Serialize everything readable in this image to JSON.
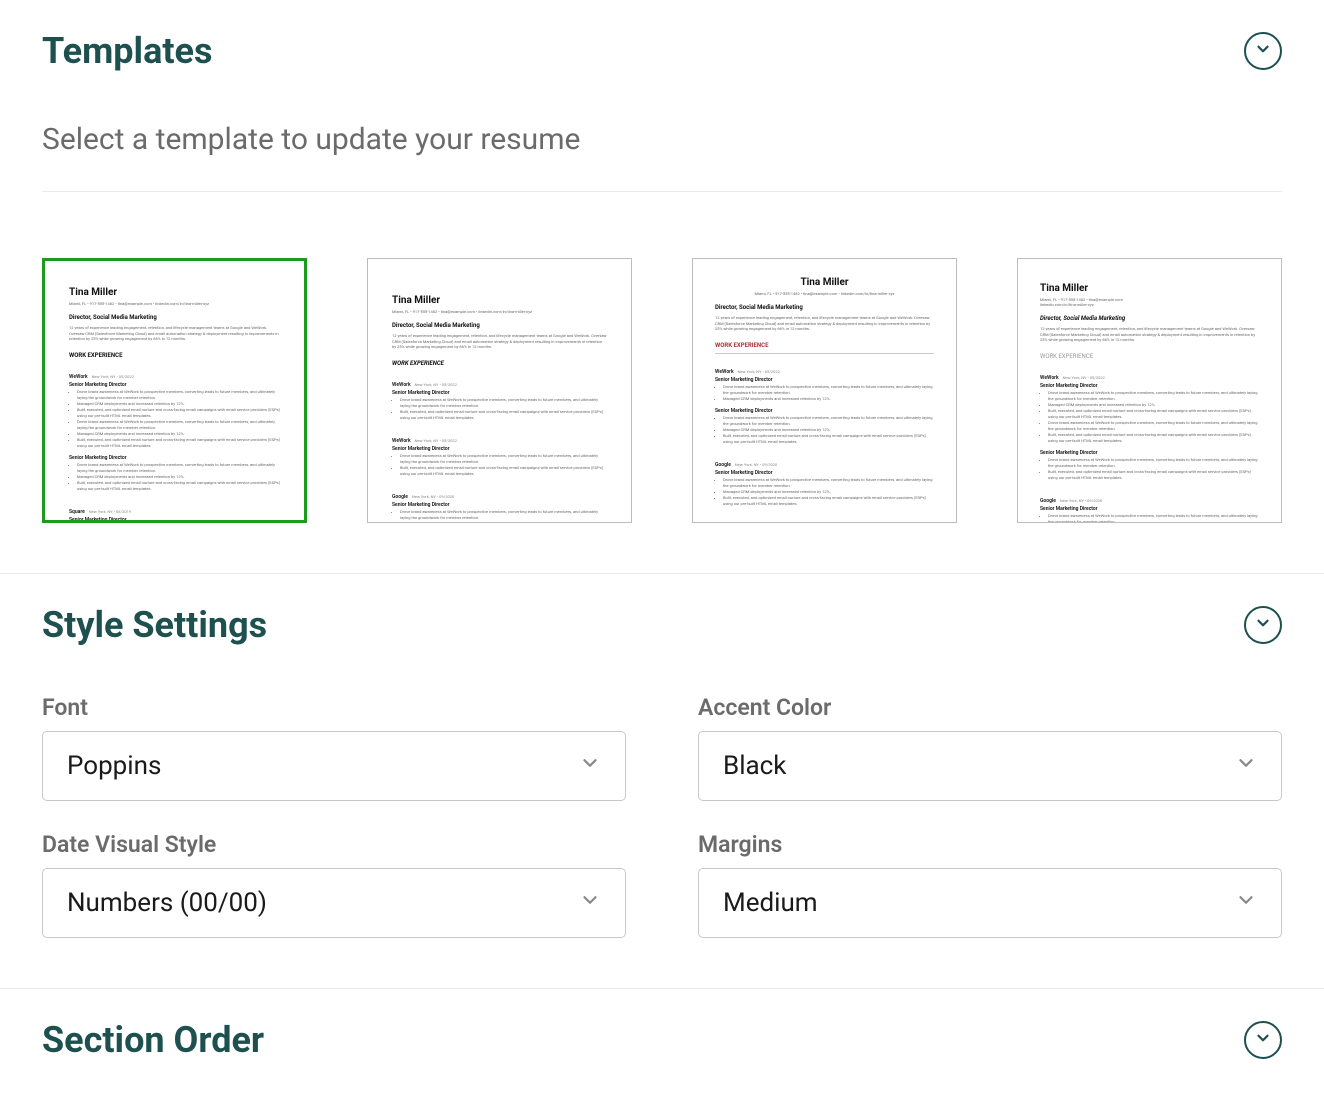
{
  "templates": {
    "title": "Templates",
    "instruction": "Select a template to update your resume",
    "preview": {
      "name": "Tina Miller",
      "contact": "Miami, FL • 917-555-1482 • tina@example.com • linkedin.com/in/tina-miller-xyz",
      "role": "Director, Social Media Marketing",
      "summary": "12 years of experience leading engagement, retention, and lifecycle management teams at Google and WeWork. Oversaw CRM (Salesforce Marketing Cloud) and email automation strategy & deployment resulting in improvements in retention by 25% while growing engagement by 66% in 12 months.",
      "section_head": "WORK EXPERIENCE",
      "jobs": [
        {
          "company": "WeWork",
          "meta": "New York, NY • 05/2022",
          "title": "Senior Marketing Director"
        },
        {
          "company": "Google",
          "meta": "New York, NY • 09/2020",
          "title": "Senior Marketing Director"
        },
        {
          "company": "Square",
          "meta": "New York, NY • 08/2019",
          "title": "Senior Marketing Director"
        }
      ],
      "bullets": [
        "Drove brand awareness at WeWork to prospective members, converting leads to future members, and ultimately laying the groundwork for member retention.",
        "Managed CRM deployments and increased retention by 12%.",
        "Built, executed, and optimized email nurture and cross-facing email campaigns with email service providers (ESPs) using our pre-built HTML email templates."
      ]
    }
  },
  "style_settings": {
    "title": "Style Settings",
    "fields": {
      "font": {
        "label": "Font",
        "value": "Poppins"
      },
      "accent_color": {
        "label": "Accent Color",
        "value": "Black"
      },
      "date_style": {
        "label": "Date Visual Style",
        "value": "Numbers (00/00)"
      },
      "margins": {
        "label": "Margins",
        "value": "Medium"
      }
    }
  },
  "section_order": {
    "title": "Section Order"
  }
}
